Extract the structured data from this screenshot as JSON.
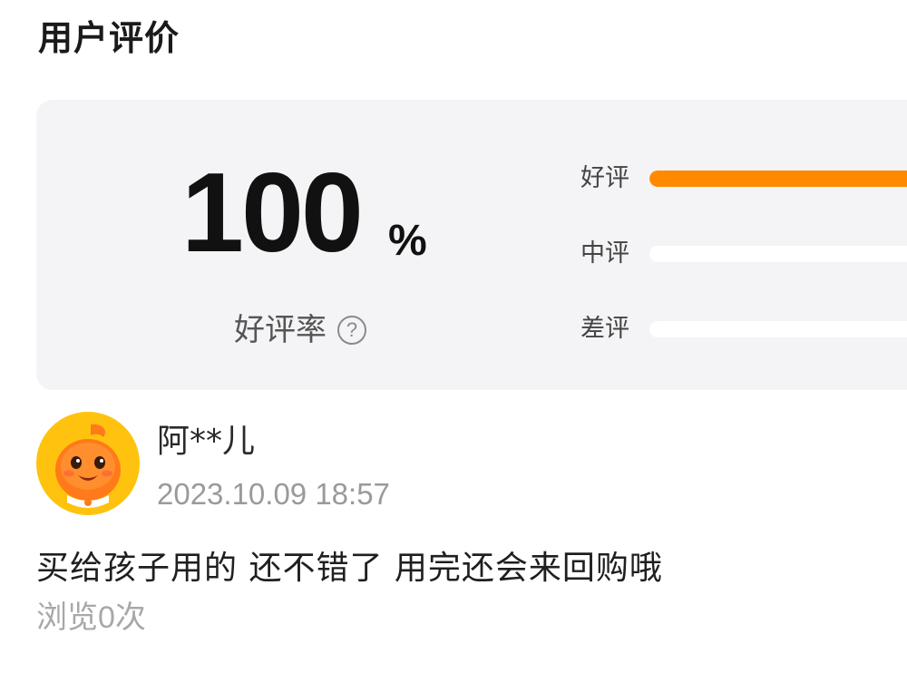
{
  "section": {
    "title": "用户评价"
  },
  "summary": {
    "rate_value": "100",
    "rate_unit": "%",
    "rate_label": "好评率",
    "help_glyph": "?",
    "bars": [
      {
        "label": "好评",
        "fraction": 1.0
      },
      {
        "label": "中评",
        "fraction": 0.0
      },
      {
        "label": "差评",
        "fraction": 0.0
      }
    ]
  },
  "review": {
    "reviewer_name": "阿**儿",
    "timestamp": "2023.10.09 18:57",
    "text": "买给孩子用的 还不错了 用完还会来回购哦",
    "views_prefix": "浏览",
    "views_count": "0",
    "views_suffix": "次"
  },
  "colors": {
    "accent": "#ff8a00",
    "card_bg": "#f4f4f6",
    "muted_text": "#9a9a9a",
    "avatar_bg": "#ffc20e"
  },
  "icons": {
    "help": "question-circle-icon",
    "avatar": "orange-mascot-avatar"
  }
}
